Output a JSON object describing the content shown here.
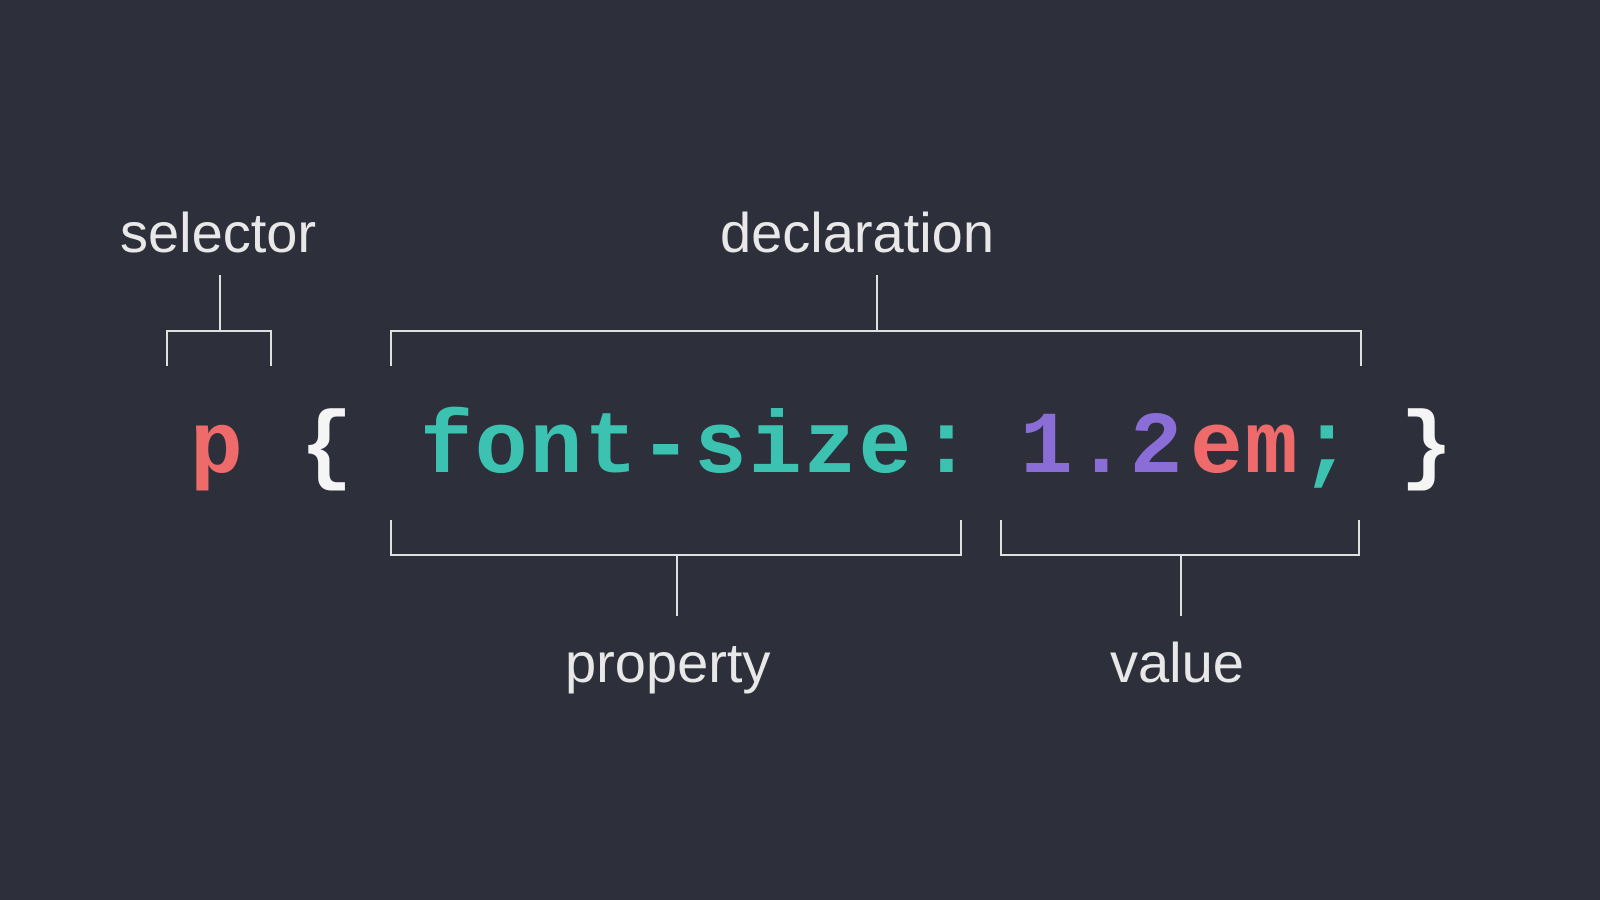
{
  "labels": {
    "selector": "selector",
    "declaration": "declaration",
    "property": "property",
    "value": "value"
  },
  "code": {
    "selector": "p",
    "open_brace": "{",
    "property": "font-size",
    "colon": ":",
    "number": "1.2",
    "unit": "em",
    "semicolon": ";",
    "close_brace": "}"
  },
  "colors": {
    "background": "#2d2f3a",
    "label_text": "#e8e8e8",
    "bracket_line": "#e0e0e0",
    "selector": "#ef6a6a",
    "brace": "#f5f5f5",
    "property": "#3cc2b0",
    "number": "#8b6dd8",
    "unit": "#ef6a6a"
  }
}
